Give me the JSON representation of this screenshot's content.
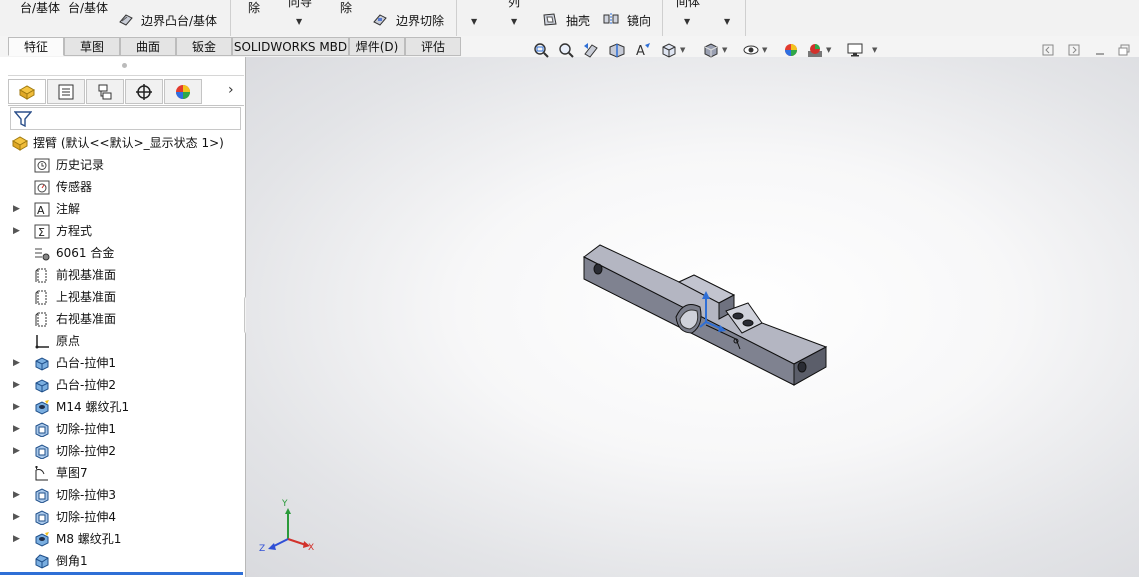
{
  "ribbon": {
    "left_top": "台/基体",
    "left_top2": "台/基体",
    "boss_boundary": "边界凸台/基体",
    "remove_label": "除",
    "wizard_label": "向导",
    "remove_label2": "除",
    "cut_boundary": "边界切除",
    "array_label": "列",
    "shell_label": "抽壳",
    "mirror_label": "镜向",
    "body_label": "间体"
  },
  "tabs": [
    "特征",
    "草图",
    "曲面",
    "钣金",
    "SOLIDWORKS MBD",
    "焊件(D)",
    "评估"
  ],
  "active_tab": "特征",
  "tree": {
    "root": "摆臂  (默认<<默认>_显示状态 1>)",
    "items": [
      {
        "label": "历史记录",
        "icon": "history-icon",
        "expandable": false
      },
      {
        "label": "传感器",
        "icon": "sensor-icon",
        "expandable": false
      },
      {
        "label": "注解",
        "icon": "annotation-icon",
        "expandable": true
      },
      {
        "label": "方程式",
        "icon": "equation-icon",
        "expandable": true
      },
      {
        "label": "6061 合金",
        "icon": "material-icon",
        "expandable": false
      },
      {
        "label": "前视基准面",
        "icon": "plane-icon",
        "expandable": false
      },
      {
        "label": "上视基准面",
        "icon": "plane-icon",
        "expandable": false
      },
      {
        "label": "右视基准面",
        "icon": "plane-icon",
        "expandable": false
      },
      {
        "label": "原点",
        "icon": "origin-icon",
        "expandable": false
      },
      {
        "label": "凸台-拉伸1",
        "icon": "boss-extrude-icon",
        "expandable": true
      },
      {
        "label": "凸台-拉伸2",
        "icon": "boss-extrude-icon",
        "expandable": true
      },
      {
        "label": "M14 螺纹孔1",
        "icon": "hole-wizard-icon",
        "expandable": true
      },
      {
        "label": "切除-拉伸1",
        "icon": "cut-extrude-icon",
        "expandable": true
      },
      {
        "label": "切除-拉伸2",
        "icon": "cut-extrude-icon",
        "expandable": true
      },
      {
        "label": "草图7",
        "icon": "sketch-icon",
        "expandable": false
      },
      {
        "label": "切除-拉伸3",
        "icon": "cut-extrude-icon",
        "expandable": true
      },
      {
        "label": "切除-拉伸4",
        "icon": "cut-extrude-icon",
        "expandable": true
      },
      {
        "label": "M8 螺纹孔1",
        "icon": "hole-wizard-icon",
        "expandable": true
      },
      {
        "label": "倒角1",
        "icon": "chamfer-icon",
        "expandable": false
      }
    ]
  },
  "triad": {
    "x": "X",
    "y": "Y",
    "z": "Z"
  },
  "colors": {
    "accent": "#2f6fd6",
    "part_face": "#b4b6c2",
    "part_edge": "#1a1a1a"
  }
}
